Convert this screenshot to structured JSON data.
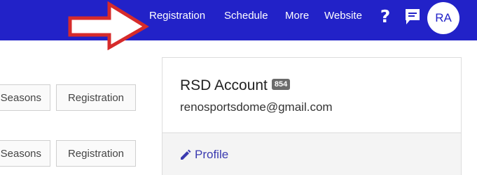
{
  "colors": {
    "accent": "#2222c8",
    "arrow": "#d62b2b",
    "link": "#3b3bb0"
  },
  "topbar": {
    "nav": [
      {
        "label": "Registration"
      },
      {
        "label": "Schedule"
      },
      {
        "label": "More"
      },
      {
        "label": "Website"
      }
    ],
    "help_icon": "question-mark-icon",
    "chat_icon": "chat-bubble-icon",
    "avatar_initials": "RA",
    "callout_icon": "red-arrow-callout"
  },
  "rows": [
    {
      "seasons_label": "Seasons",
      "registration_label": "Registration"
    },
    {
      "seasons_label": "Seasons",
      "registration_label": "Registration"
    }
  ],
  "account_card": {
    "title": "RSD Account",
    "badge": "854",
    "email": "renosportsdome@gmail.com",
    "profile_label": "Profile",
    "profile_icon": "pencil-icon"
  }
}
